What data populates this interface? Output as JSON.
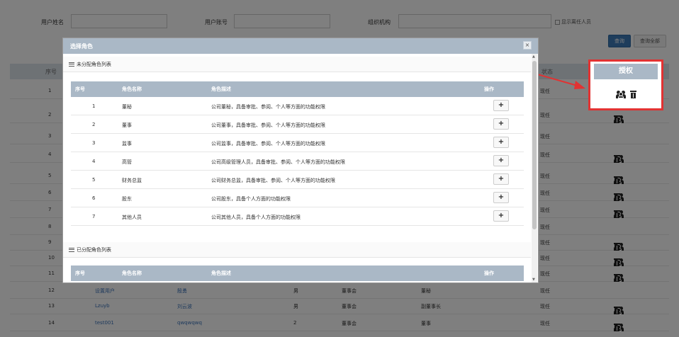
{
  "filters": {
    "username_label": "用户姓名",
    "account_label": "用户账号",
    "org_label": "组织机构",
    "show_retired_label": "显示离任人员",
    "query_button": "查询",
    "query_all_button": "查询全部"
  },
  "bg_table": {
    "columns": [
      "序号",
      "状态"
    ],
    "rows": [
      {
        "no": "1",
        "status": "现任"
      },
      {
        "no": "2",
        "status": "现任"
      },
      {
        "no": "3",
        "status": "现任"
      },
      {
        "no": "4",
        "status": "现任"
      },
      {
        "no": "5",
        "status": "现任"
      },
      {
        "no": "6",
        "status": "现任"
      },
      {
        "no": "7",
        "status": "现任"
      },
      {
        "no": "8",
        "status": "现任"
      },
      {
        "no": "9",
        "status": "现任"
      },
      {
        "no": "10",
        "status": "现任"
      },
      {
        "no": "11",
        "status": "现任"
      },
      {
        "no": "12",
        "name": "设置用户",
        "account": "殷勇",
        "gender": "男",
        "org": "董事会",
        "role": "董秘",
        "status": "现任"
      },
      {
        "no": "13",
        "name": "Lzuyb",
        "account": "刘云波",
        "gender": "男",
        "org": "董事会",
        "role": "副董事长",
        "status": "现任"
      },
      {
        "no": "14",
        "name": "test001",
        "account": "qwqwqwq",
        "gender": "2",
        "org": "董事会",
        "role": "董事",
        "status": "现任"
      }
    ]
  },
  "callout": {
    "header": "授权",
    "icons": [
      "users-icon",
      "trash-icon"
    ],
    "border_color": "#e23232"
  },
  "modal": {
    "title": "选择角色",
    "close_label": "×",
    "unassigned_section": "未分配角色列表",
    "assigned_section": "已分配角色列表",
    "columns": [
      "序号",
      "角色名称",
      "角色描述",
      "操作"
    ],
    "add_label": "+",
    "unassigned_rows": [
      {
        "no": "1",
        "name": "董秘",
        "desc": "公司董秘，具备审批、参阅、个人等方面的功能权限"
      },
      {
        "no": "2",
        "name": "董事",
        "desc": "公司董事，具备审批、参阅、个人等方面的功能权限"
      },
      {
        "no": "3",
        "name": "监事",
        "desc": "公司监事，具备审批、参阅、个人等方面的功能权限"
      },
      {
        "no": "4",
        "name": "高管",
        "desc": "公司高级管理人员，具备审批、参阅、个人等方面的功能权限"
      },
      {
        "no": "5",
        "name": "财务总监",
        "desc": "公司财务总监，具备审批、参阅、个人等方面的功能权限"
      },
      {
        "no": "6",
        "name": "股东",
        "desc": "公司股东，具备个人方面的功能权限"
      },
      {
        "no": "7",
        "name": "其他人员",
        "desc": "公司其他人员，具备个人方面的功能权限"
      }
    ]
  },
  "colors": {
    "header_bg": "#aab8c6",
    "primary": "#3d7ab8",
    "highlight": "#e23232"
  }
}
